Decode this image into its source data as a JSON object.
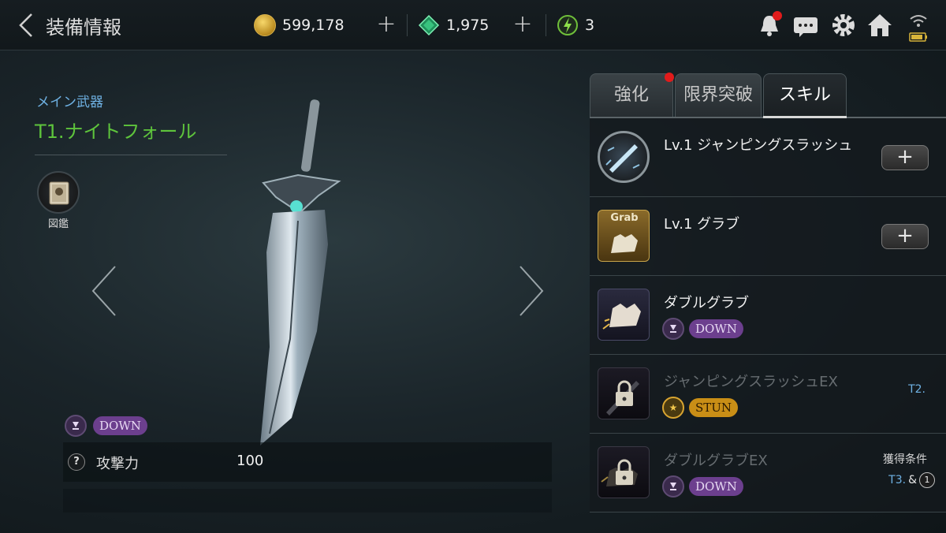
{
  "header": {
    "title": "装備情報",
    "gold": "599,178",
    "gems": "1,975",
    "energy": "3"
  },
  "weapon": {
    "slot_label": "メイン武器",
    "name": "T1.ナイトフォール",
    "codex_label": "図鑑",
    "effect_label": "DOWN",
    "stat_label": "攻撃力",
    "stat_value": "100",
    "help_glyph": "?"
  },
  "tabs": [
    {
      "label": "強化",
      "notification": true
    },
    {
      "label": "限界突破",
      "notification": false
    },
    {
      "label": "スキル",
      "notification": false,
      "active": true
    }
  ],
  "skills": [
    {
      "name": "Lv.1 ジャンピングスラッシュ",
      "locked": false,
      "icon_text": ""
    },
    {
      "name": "Lv.1 グラブ",
      "locked": false,
      "icon_text": "Grab"
    },
    {
      "name": "ダブルグラブ",
      "locked": false,
      "badge": "DOWN"
    },
    {
      "name": "ジャンピングスラッシュEX",
      "locked": true,
      "badge": "STUN",
      "requirement": "T2."
    },
    {
      "name": "ダブルグラブEX",
      "locked": true,
      "badge": "DOWN",
      "requirement_title": "獲得条件",
      "requirement_tier": "T3.",
      "requirement_amp": "&",
      "requirement_num": "1"
    }
  ],
  "colors": {
    "accent_green": "#5ec43c",
    "accent_blue": "#6fb2e4",
    "down_purple": "#6c3f8e",
    "stun_gold": "#c98e16",
    "notification_red": "#e11b1b"
  }
}
